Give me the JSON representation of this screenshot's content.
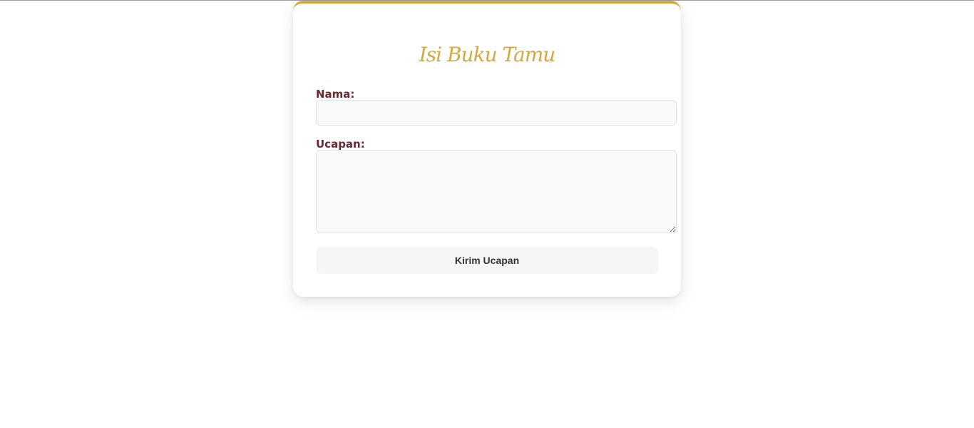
{
  "form": {
    "title": "Isi Buku Tamu",
    "name_label": "Nama:",
    "name_value": "",
    "message_label": "Ucapan:",
    "message_value": "",
    "submit_label": "Kirim Ucapan"
  },
  "colors": {
    "accent": "#d4a843",
    "label": "#6b2a33",
    "field_bg": "#f9f9f9",
    "button_bg": "#f6f6f6"
  }
}
